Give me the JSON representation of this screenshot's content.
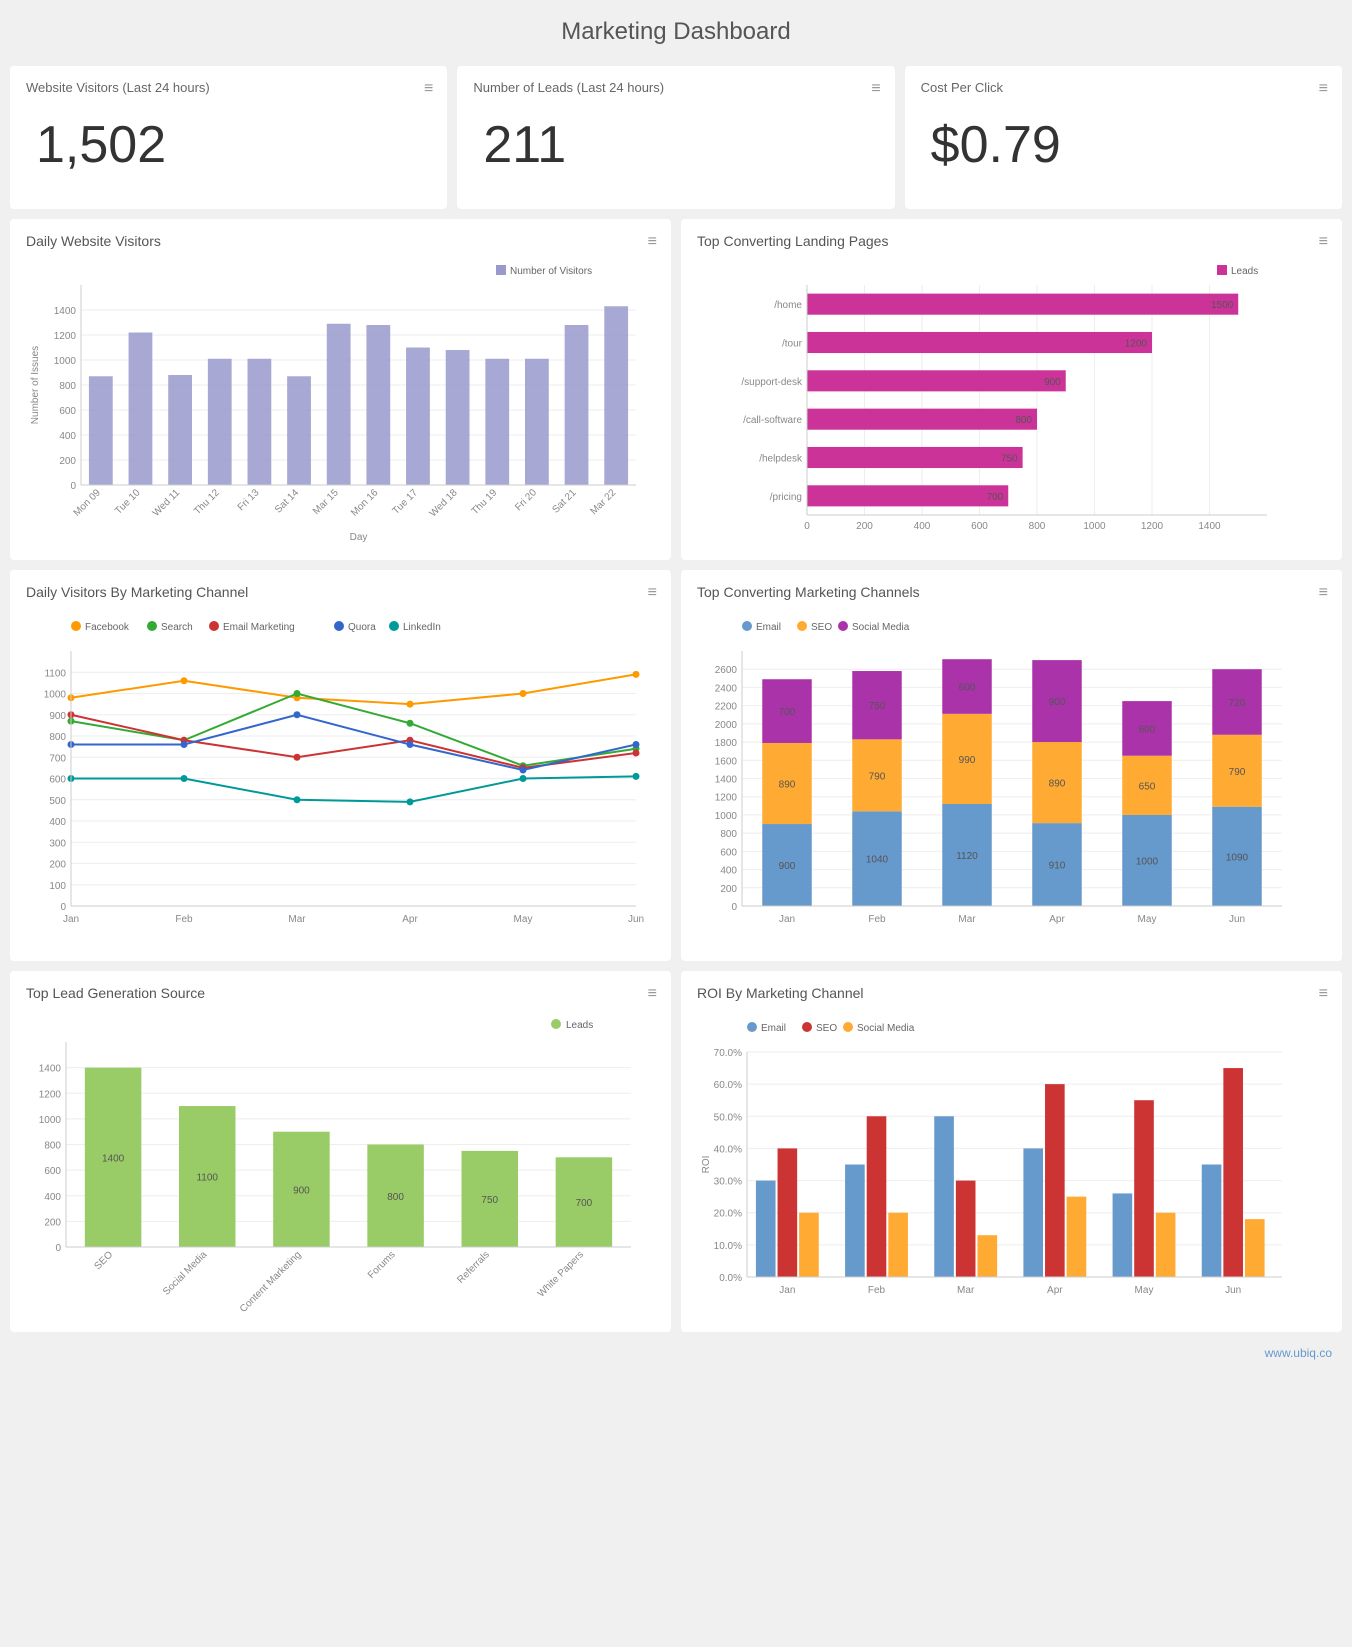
{
  "title": "Marketing Dashboard",
  "stats": [
    {
      "label": "Website Visitors (Last 24 hours)",
      "value": "1,502"
    },
    {
      "label": "Number of Leads (Last 24 hours)",
      "value": "211"
    },
    {
      "label": "Cost Per Click",
      "value": "$0.79"
    }
  ],
  "daily_visitors": {
    "title": "Daily Website Visitors",
    "legend": "Number of Visitors",
    "y_label": "Number of Issues",
    "x_label": "Day",
    "bars": [
      {
        "day": "Mon 09",
        "val": 870
      },
      {
        "day": "Tue 10",
        "val": 1220
      },
      {
        "day": "Wed 11",
        "val": 880
      },
      {
        "day": "Thu 12",
        "val": 1010
      },
      {
        "day": "Fri 13",
        "val": 1010
      },
      {
        "day": "Sat 14",
        "val": 870
      },
      {
        "day": "Mar 15",
        "val": 1290
      },
      {
        "day": "Mon 16",
        "val": 1280
      },
      {
        "day": "Tue 17",
        "val": 1100
      },
      {
        "day": "Wed 18",
        "val": 1080
      },
      {
        "day": "Thu 19",
        "val": 1010
      },
      {
        "day": "Fri 20",
        "val": 1010
      },
      {
        "day": "Sat 21",
        "val": 1280
      },
      {
        "day": "Mar 22",
        "val": 1430
      }
    ],
    "max": 1500
  },
  "landing_pages": {
    "title": "Top Converting Landing Pages",
    "legend": "Leads",
    "pages": [
      {
        "page": "/home",
        "val": 1500
      },
      {
        "page": "/tour",
        "val": 1200
      },
      {
        "page": "/support-desk",
        "val": 900
      },
      {
        "page": "/call-software",
        "val": 800
      },
      {
        "page": "/helpdesk",
        "val": 750
      },
      {
        "page": "/pricing",
        "val": 700
      }
    ],
    "max": 1500
  },
  "daily_channels": {
    "title": "Daily Visitors By Marketing Channel",
    "legends": [
      "Facebook",
      "Search",
      "Email Marketing",
      "Quora",
      "LinkedIn"
    ],
    "months": [
      "Jan",
      "Feb",
      "Mar",
      "Apr",
      "May",
      "Jun"
    ],
    "data": {
      "Facebook": [
        980,
        1060,
        980,
        950,
        1000,
        1090
      ],
      "Search": [
        870,
        780,
        1000,
        860,
        660,
        740
      ],
      "Email Marketing": [
        900,
        780,
        700,
        780,
        650,
        720
      ],
      "Quora": [
        760,
        760,
        900,
        760,
        640,
        760
      ],
      "LinkedIn": [
        600,
        600,
        500,
        490,
        600,
        610
      ]
    }
  },
  "top_channels": {
    "title": "Top Converting Marketing Channels",
    "legends": [
      "Email",
      "SEO",
      "Social Media"
    ],
    "months": [
      "Jan",
      "Feb",
      "Mar",
      "Apr",
      "May",
      "Jun"
    ],
    "data": {
      "Email": [
        900,
        1040,
        1120,
        910,
        1000,
        1090
      ],
      "SEO": [
        890,
        790,
        990,
        890,
        650,
        790
      ],
      "Social Media": [
        700,
        750,
        600,
        900,
        600,
        720
      ]
    }
  },
  "lead_source": {
    "title": "Top Lead Generation Source",
    "legend": "Leads",
    "bars": [
      {
        "src": "SEO",
        "val": 1400
      },
      {
        "src": "Social Media",
        "val": 1100
      },
      {
        "src": "Content Marketing",
        "val": 900
      },
      {
        "src": "Forums",
        "val": 800
      },
      {
        "src": "Referrals",
        "val": 750
      },
      {
        "src": "White Papers",
        "val": 700
      }
    ],
    "max": 1400
  },
  "roi": {
    "title": "ROI By Marketing Channel",
    "legends": [
      "Email",
      "SEO",
      "Social Media"
    ],
    "months": [
      "Jan",
      "Feb",
      "Mar",
      "Apr",
      "May",
      "Jun"
    ],
    "data": {
      "Email": [
        30,
        35,
        50,
        40,
        26,
        35
      ],
      "SEO": [
        40,
        50,
        30,
        60,
        55,
        65
      ],
      "Social Media": [
        20,
        20,
        13,
        25,
        20,
        18
      ]
    },
    "max": 70
  },
  "footer": "www.ubiq.co",
  "colors": {
    "blue_bar": "#9999cc",
    "magenta": "#cc3399",
    "orange": "#ff9900",
    "green_search": "#33aa33",
    "red_email": "#cc3333",
    "purple_quora": "#6633cc",
    "teal_linkedin": "#009999",
    "email_blue": "#6699cc",
    "seo_orange": "#ffaa33",
    "social_purple": "#aa33aa",
    "lead_green": "#99cc66",
    "roi_email": "#6699cc",
    "roi_seo": "#cc3333",
    "roi_social": "#ffaa33"
  }
}
